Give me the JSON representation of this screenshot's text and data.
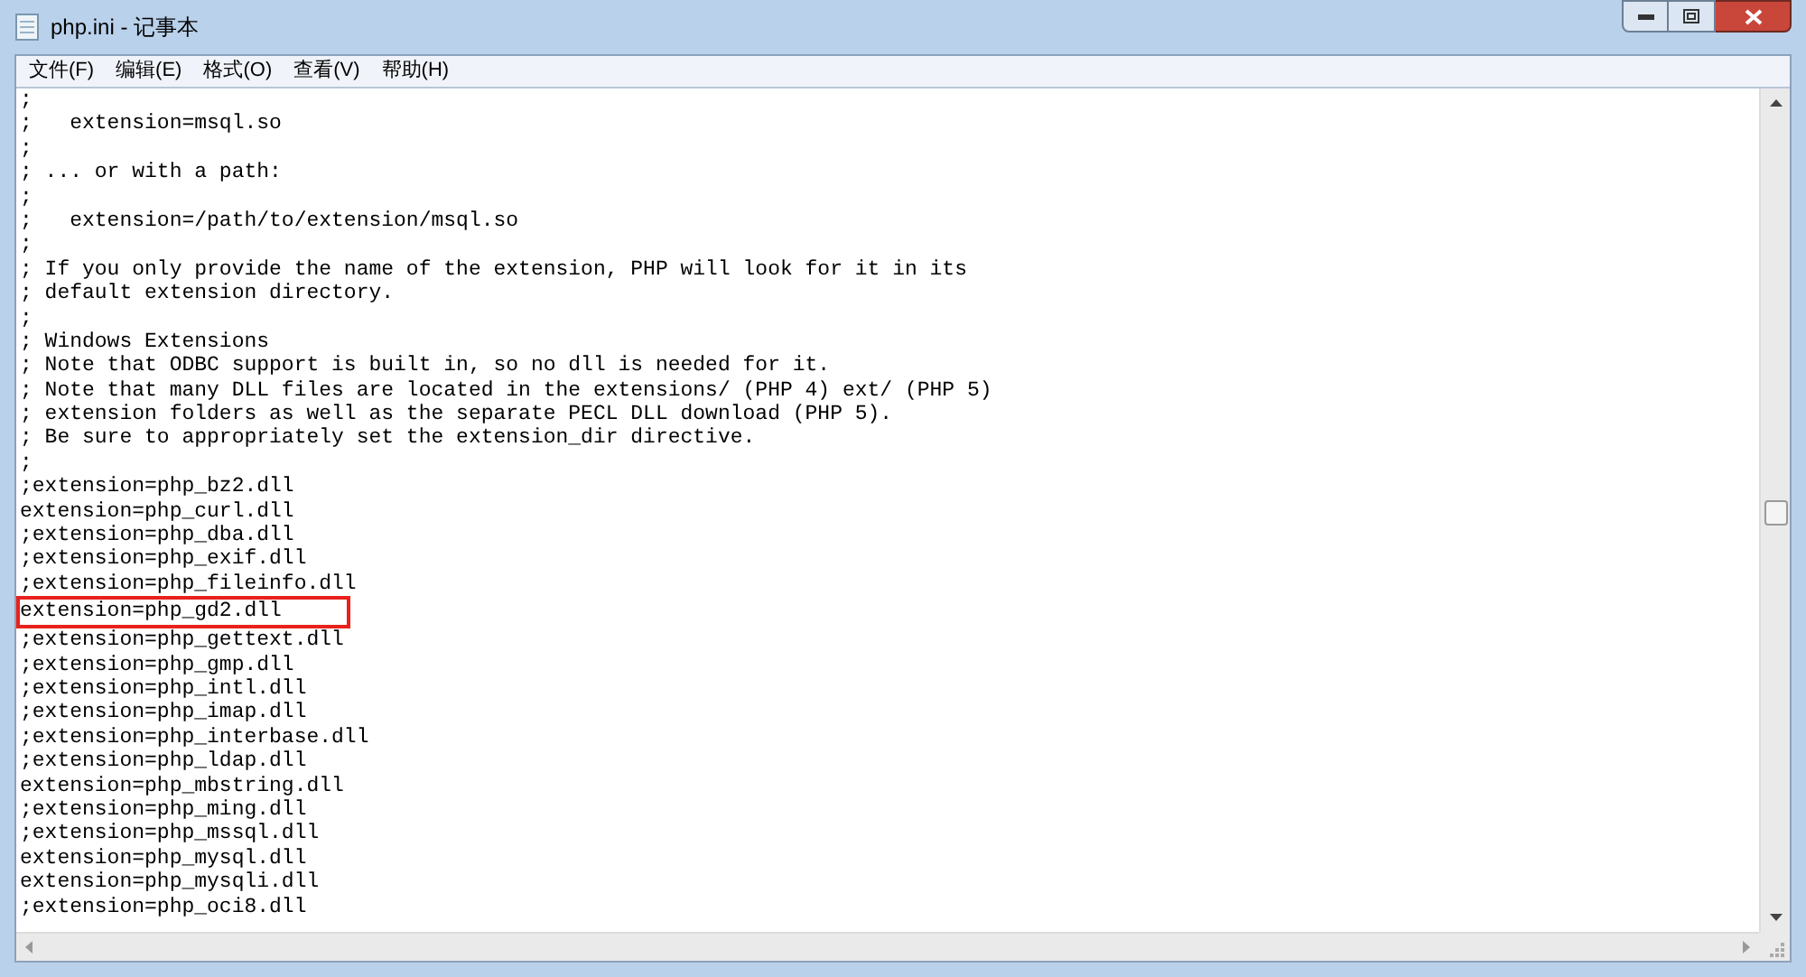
{
  "window": {
    "title": "php.ini - 记事本"
  },
  "menu": [
    "文件(F)",
    "编辑(E)",
    "格式(O)",
    "查看(V)",
    "帮助(H)"
  ],
  "lines": [
    {
      "text": ";",
      "highlighted": false
    },
    {
      "text": ";   extension=msql.so",
      "highlighted": false
    },
    {
      "text": ";",
      "highlighted": false
    },
    {
      "text": "; ... or with a path:",
      "highlighted": false
    },
    {
      "text": ";",
      "highlighted": false
    },
    {
      "text": ";   extension=/path/to/extension/msql.so",
      "highlighted": false
    },
    {
      "text": ";",
      "highlighted": false
    },
    {
      "text": "; If you only provide the name of the extension, PHP will look for it in its",
      "highlighted": false
    },
    {
      "text": "; default extension directory.",
      "highlighted": false
    },
    {
      "text": ";",
      "highlighted": false
    },
    {
      "text": "; Windows Extensions",
      "highlighted": false
    },
    {
      "text": "; Note that ODBC support is built in, so no dll is needed for it.",
      "highlighted": false
    },
    {
      "text": "; Note that many DLL files are located in the extensions/ (PHP 4) ext/ (PHP 5)",
      "highlighted": false
    },
    {
      "text": "; extension folders as well as the separate PECL DLL download (PHP 5).",
      "highlighted": false
    },
    {
      "text": "; Be sure to appropriately set the extension_dir directive.",
      "highlighted": false
    },
    {
      "text": ";",
      "highlighted": false
    },
    {
      "text": ";extension=php_bz2.dll",
      "highlighted": false
    },
    {
      "text": "extension=php_curl.dll",
      "highlighted": false
    },
    {
      "text": ";extension=php_dba.dll",
      "highlighted": false
    },
    {
      "text": ";extension=php_exif.dll",
      "highlighted": false
    },
    {
      "text": ";extension=php_fileinfo.dll",
      "highlighted": false
    },
    {
      "text": "extension=php_gd2.dll",
      "highlighted": true
    },
    {
      "text": ";extension=php_gettext.dll",
      "highlighted": false
    },
    {
      "text": ";extension=php_gmp.dll",
      "highlighted": false
    },
    {
      "text": ";extension=php_intl.dll",
      "highlighted": false
    },
    {
      "text": ";extension=php_imap.dll",
      "highlighted": false
    },
    {
      "text": ";extension=php_interbase.dll",
      "highlighted": false
    },
    {
      "text": ";extension=php_ldap.dll",
      "highlighted": false
    },
    {
      "text": "extension=php_mbstring.dll",
      "highlighted": false
    },
    {
      "text": ";extension=php_ming.dll",
      "highlighted": false
    },
    {
      "text": ";extension=php_mssql.dll",
      "highlighted": false
    },
    {
      "text": "extension=php_mysql.dll",
      "highlighted": false
    },
    {
      "text": "extension=php_mysqli.dll",
      "highlighted": false
    },
    {
      "text": ";extension=php_oci8.dll",
      "highlighted": false
    }
  ]
}
